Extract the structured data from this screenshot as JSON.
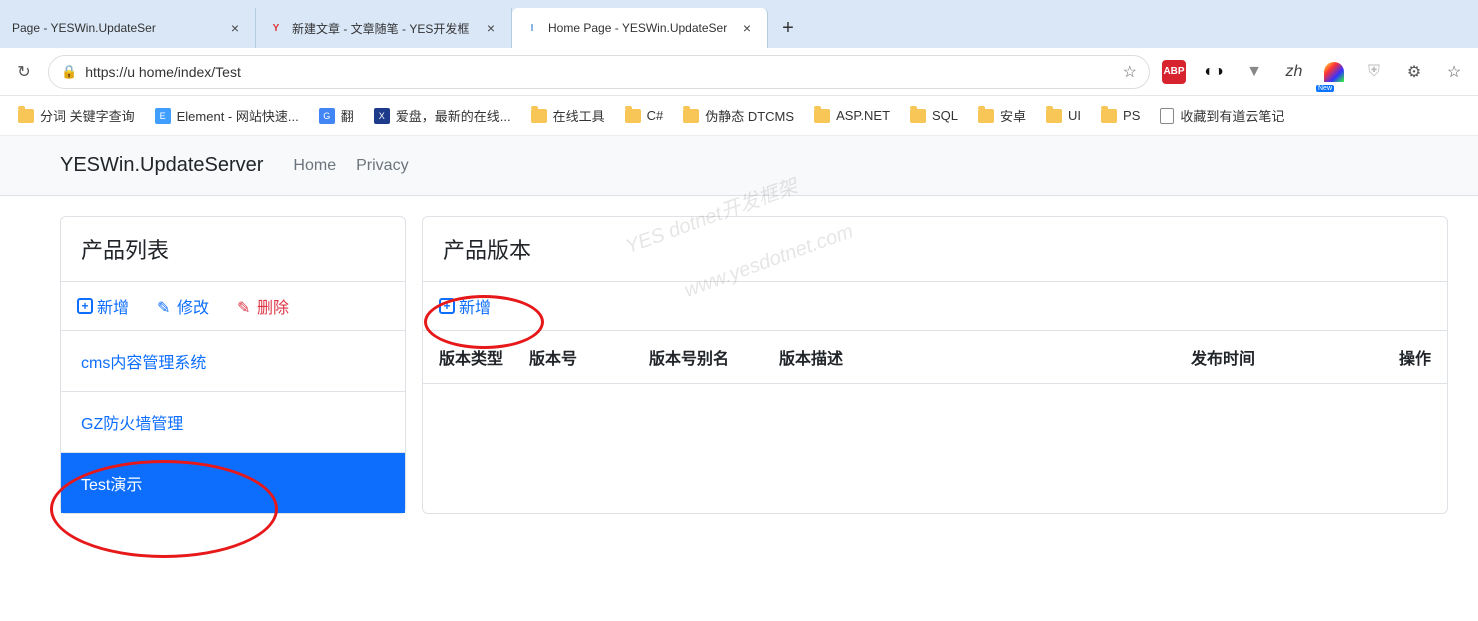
{
  "browser": {
    "tabs": [
      {
        "title": "Page - YESWin.UpdateSer",
        "active": false,
        "favicon": ""
      },
      {
        "title": "新建文章 - 文章随笔 - YES开发框",
        "active": false,
        "favicon": "Y"
      },
      {
        "title": "Home Page - YESWin.UpdateSer",
        "active": true,
        "favicon": "I"
      }
    ],
    "url": "https://u                                 home/index/Test",
    "bookmarks": [
      {
        "label": "分词 关键字查询",
        "type": "folder"
      },
      {
        "label": "Element - 网站快速...",
        "type": "page",
        "icon": "el"
      },
      {
        "label": "翻",
        "type": "page",
        "icon": "g"
      },
      {
        "label": "爱盘，最新的在线...",
        "type": "page",
        "icon": "x"
      },
      {
        "label": "在线工具",
        "type": "folder"
      },
      {
        "label": "C#",
        "type": "folder"
      },
      {
        "label": "伪静态 DTCMS",
        "type": "folder"
      },
      {
        "label": "ASP.NET",
        "type": "folder"
      },
      {
        "label": "SQL",
        "type": "folder"
      },
      {
        "label": "安卓",
        "type": "folder"
      },
      {
        "label": "UI",
        "type": "folder"
      },
      {
        "label": "PS",
        "type": "folder"
      },
      {
        "label": "收藏到有道云笔记",
        "type": "page",
        "icon": "doc"
      }
    ]
  },
  "page": {
    "brand": "YESWin.UpdateServer",
    "nav": [
      "Home",
      "Privacy"
    ],
    "left": {
      "title": "产品列表",
      "toolbar": {
        "add": "新增",
        "edit": "修改",
        "del": "删除"
      },
      "items": [
        {
          "label": "cms内容管理系统",
          "active": false
        },
        {
          "label": "GZ防火墙管理",
          "active": false
        },
        {
          "label": "Test演示",
          "active": true
        }
      ]
    },
    "right": {
      "title": "产品版本",
      "toolbar": {
        "add": "新增"
      },
      "columns": [
        "版本类型",
        "版本号",
        "版本号别名",
        "版本描述",
        "发布时间",
        "操作"
      ]
    }
  },
  "watermark": [
    "YES dotnet开发框架",
    "www.yesdotnet.com"
  ]
}
